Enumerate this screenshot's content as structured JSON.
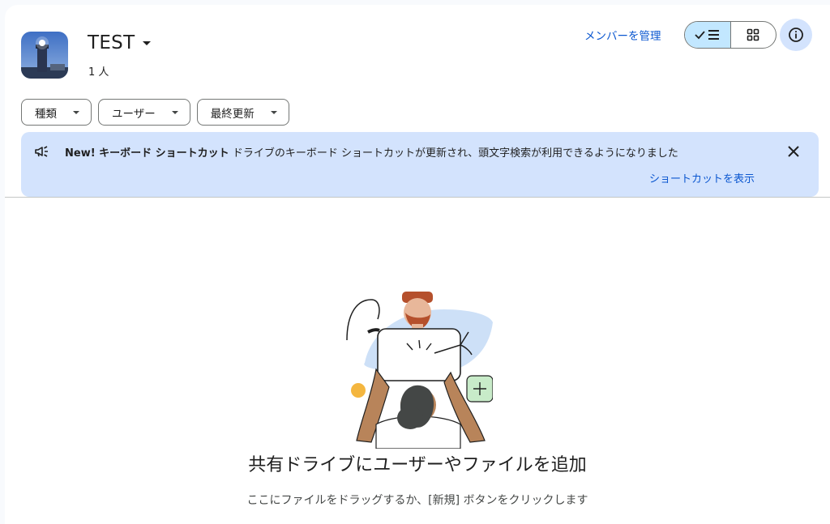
{
  "header": {
    "drive_name": "TEST",
    "member_count": "1 人",
    "manage_members": "メンバーを管理"
  },
  "filters": [
    {
      "label": "種類"
    },
    {
      "label": "ユーザー"
    },
    {
      "label": "最終更新"
    }
  ],
  "banner": {
    "title": "New! キーボード ショートカット",
    "message": "ドライブのキーボード ショートカットが更新され、頭文字検索が利用できるようになりました",
    "action": "ショートカットを表示"
  },
  "empty_state": {
    "title": "共有ドライブにユーザーやファイルを追加",
    "subtitle": "ここにファイルをドラッグするか、[新規] ボタンをクリックします"
  },
  "colors": {
    "accent": "#0b57d0",
    "banner_bg": "#d3e3fd",
    "toggle_active": "#c2e7ff"
  },
  "icons": {
    "view_list": "check-list-icon",
    "view_grid": "grid-icon",
    "info": "info-icon",
    "banner": "megaphone-icon",
    "close": "close-icon"
  }
}
